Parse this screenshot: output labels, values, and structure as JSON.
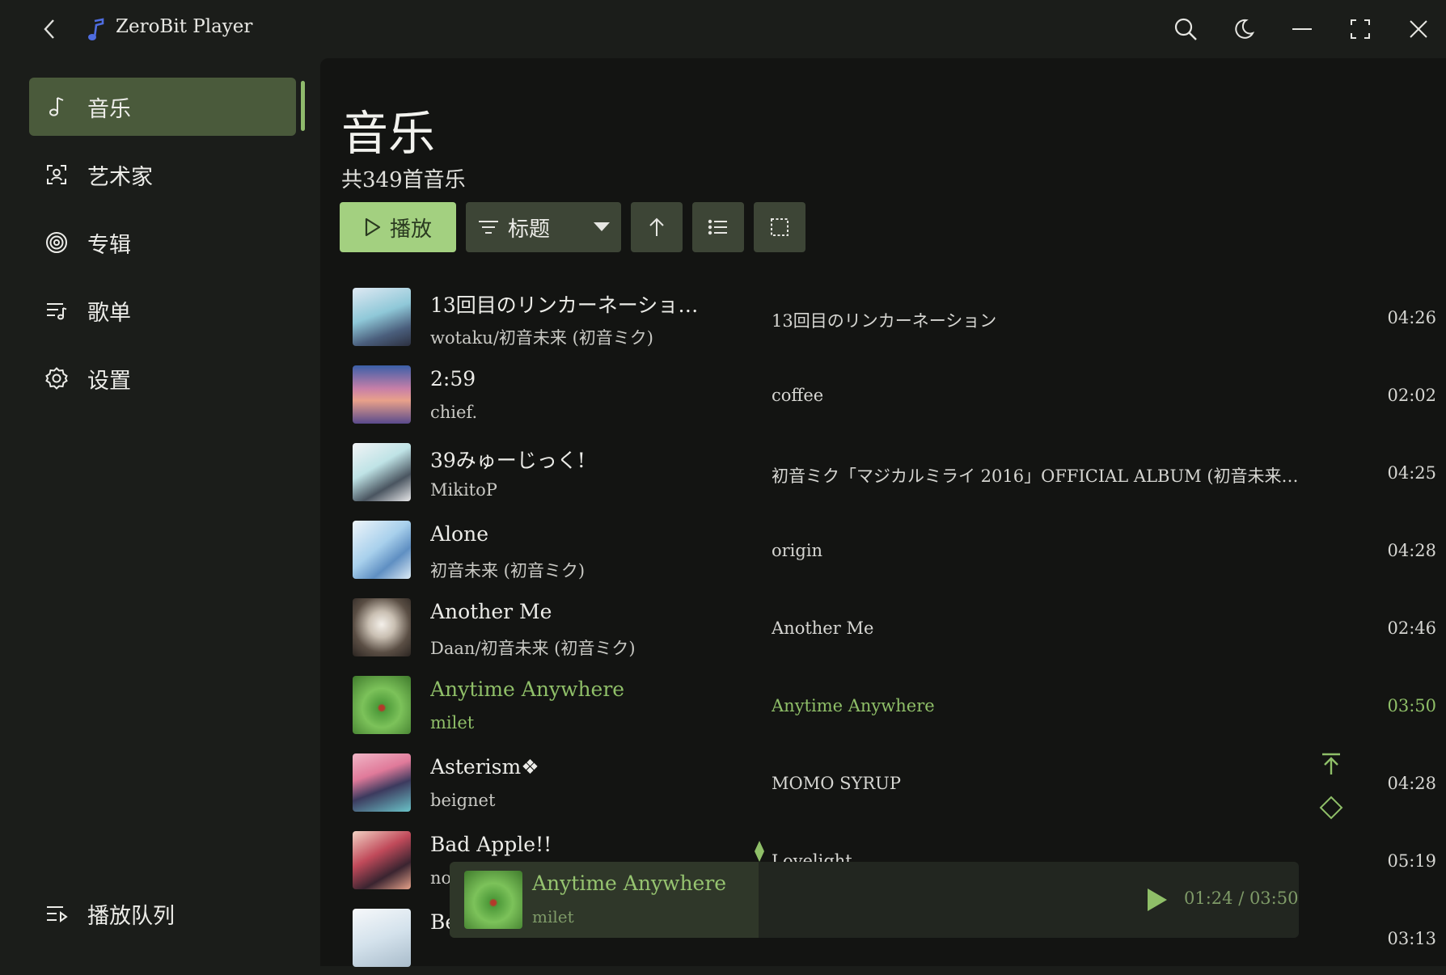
{
  "app": {
    "title": "ZeroBit Player",
    "accent": "#8fba6c"
  },
  "titlebar": {
    "icons": [
      "back-icon",
      "music-note-logo-icon",
      "search-icon",
      "moon-icon",
      "minimize-icon",
      "fullscreen-icon",
      "close-icon"
    ]
  },
  "sidebar": {
    "items": [
      {
        "label": "音乐",
        "icon": "music-note-icon",
        "active": true
      },
      {
        "label": "艺术家",
        "icon": "artist-icon",
        "active": false
      },
      {
        "label": "专辑",
        "icon": "album-disc-icon",
        "active": false
      },
      {
        "label": "歌单",
        "icon": "playlist-icon",
        "active": false
      },
      {
        "label": "设置",
        "icon": "gear-icon",
        "active": false
      }
    ],
    "queue_label": "播放队列"
  },
  "main": {
    "title": "音乐",
    "count_text": "共349首音乐",
    "toolbar": {
      "play_label": "播放",
      "sort_label": "标题"
    },
    "songs": [
      {
        "title": "13回目のリンカーネーショ…",
        "artist": "wotaku/初音未来 (初音ミク)",
        "album": "13回目のリンカーネーション",
        "duration": "04:26"
      },
      {
        "title": "2:59",
        "artist": "chief.",
        "album": "coffee",
        "duration": "02:02"
      },
      {
        "title": "39みゅーじっく!",
        "artist": "MikitoP",
        "album": "初音ミク「マジカルミライ 2016」OFFICIAL ALBUM (初音未来…",
        "duration": "04:25"
      },
      {
        "title": "Alone",
        "artist": "初音未来 (初音ミク)",
        "album": "origin",
        "duration": "04:28"
      },
      {
        "title": "Another Me",
        "artist": "Daan/初音未来 (初音ミク)",
        "album": "Another Me",
        "duration": "02:46"
      },
      {
        "title": "Anytime Anywhere",
        "artist": "milet",
        "album": "Anytime Anywhere",
        "duration": "03:50",
        "playing": true
      },
      {
        "title": "Asterism❖",
        "artist": "beignet",
        "album": "MOMO SYRUP",
        "duration": "04:28"
      },
      {
        "title": "Bad Apple!!",
        "artist": "no",
        "album": "Lovelight",
        "duration": "05:19"
      },
      {
        "title": "Be",
        "artist": "",
        "album": "",
        "duration": "03:13"
      }
    ]
  },
  "now_playing": {
    "title": "Anytime Anywhere",
    "artist": "milet",
    "time": "01:24 / 03:50"
  }
}
